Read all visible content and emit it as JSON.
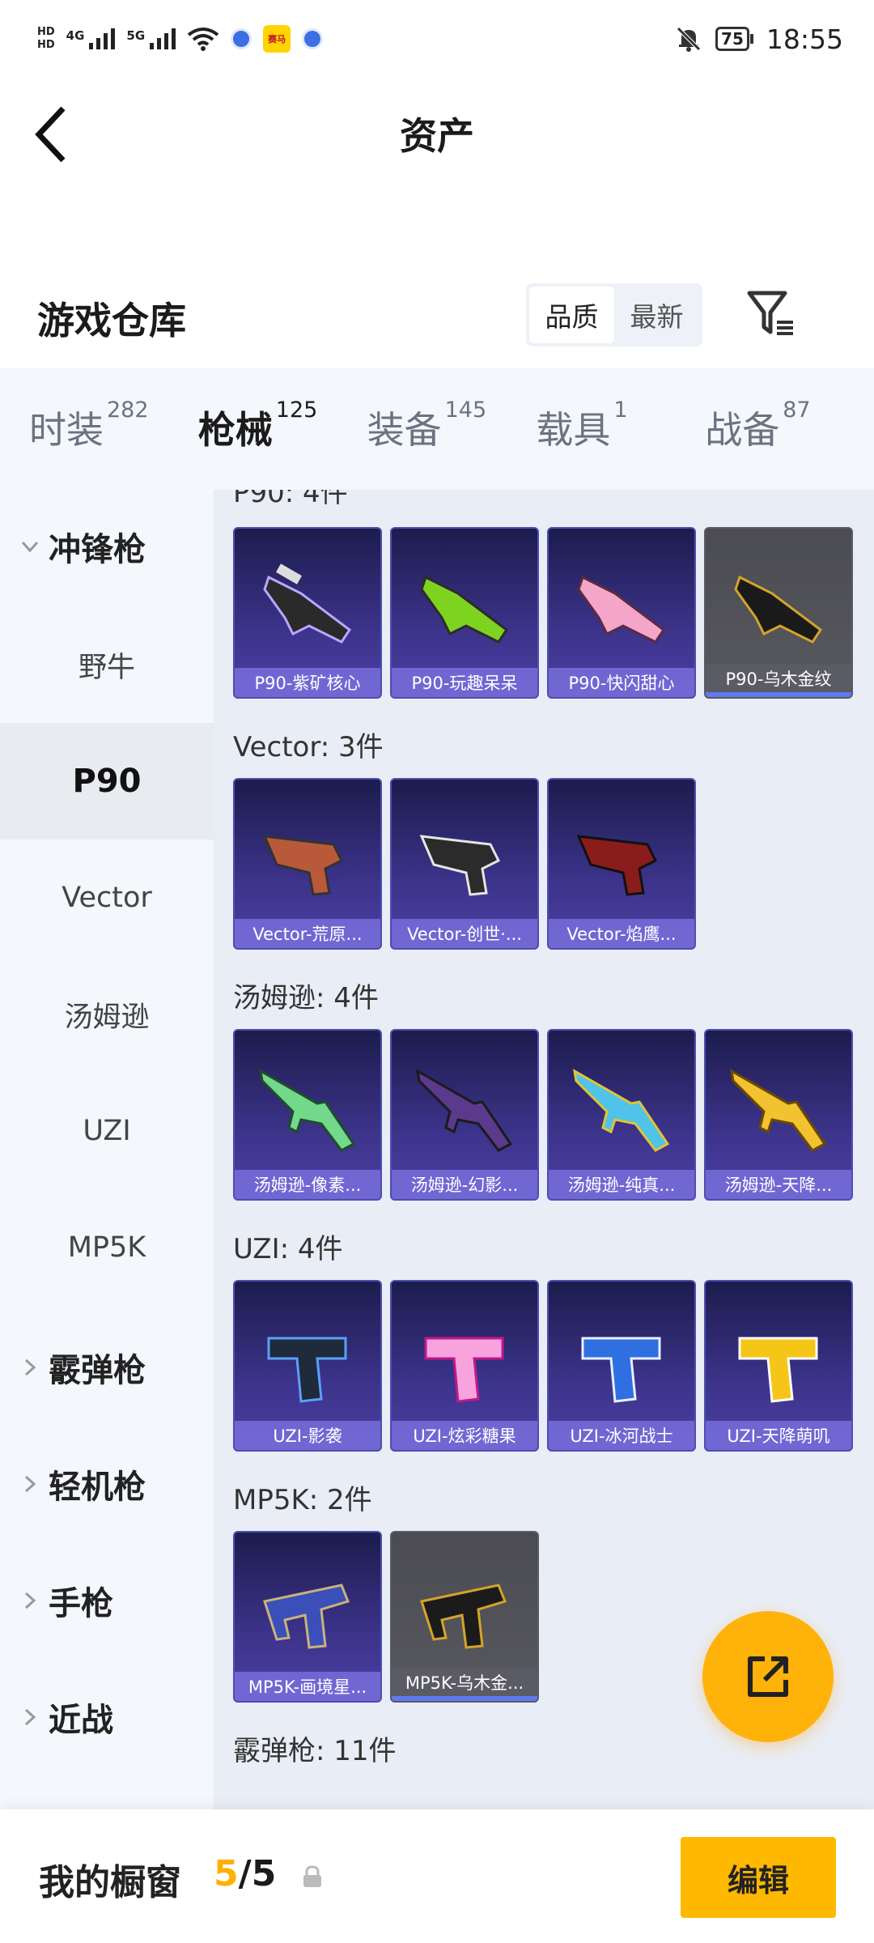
{
  "status_bar": {
    "network_labels": [
      "4G",
      "5G"
    ],
    "battery": "75",
    "time": "18:55",
    "app_icon_text": "赛马"
  },
  "header": {
    "title": "资产"
  },
  "warehouse": {
    "title": "游戏仓库",
    "sort_options": [
      "品质",
      "最新"
    ],
    "sort_selected": "品质"
  },
  "tabs": [
    {
      "label": "时装",
      "count": "282"
    },
    {
      "label": "枪械",
      "count": "125"
    },
    {
      "label": "装备",
      "count": "145"
    },
    {
      "label": "载具",
      "count": "1"
    },
    {
      "label": "战备",
      "count": "87"
    }
  ],
  "active_tab": "枪械",
  "sidebar": {
    "expanded_category": "冲锋枪",
    "subcategories": [
      "野牛",
      "P90",
      "Vector",
      "汤姆逊",
      "UZI",
      "MP5K"
    ],
    "active_subcategory": "P90",
    "collapsed_categories": [
      "霰弹枪",
      "轻机枪",
      "手枪",
      "近战"
    ]
  },
  "groups": [
    {
      "title": "P90: 4件",
      "items": [
        "P90-紫矿核心",
        "P90-玩趣呆呆",
        "P90-快闪甜心",
        "P90-乌木金纹"
      ]
    },
    {
      "title": "Vector: 3件",
      "items": [
        "Vector-荒原...",
        "Vector-创世·...",
        "Vector-焰鹰..."
      ]
    },
    {
      "title": "汤姆逊: 4件",
      "items": [
        "汤姆逊-像素...",
        "汤姆逊-幻影...",
        "汤姆逊-纯真...",
        "汤姆逊-天降..."
      ]
    },
    {
      "title": "UZI: 4件",
      "items": [
        "UZI-影袭",
        "UZI-炫彩糖果",
        "UZI-冰河战士",
        "UZI-天降萌叽"
      ]
    },
    {
      "title": "MP5K: 2件",
      "items": [
        "MP5K-画境星...",
        "MP5K-乌木金..."
      ]
    },
    {
      "title": "霰弹枪: 11件",
      "items": []
    }
  ],
  "bottom_bar": {
    "label": "我的橱窗",
    "current": "5",
    "separator": "/",
    "total": "5",
    "edit_label": "编辑"
  },
  "colors": {
    "accent": "#ffb000",
    "card_purple": "#3c338a",
    "card_gray": "#4b4b52"
  }
}
